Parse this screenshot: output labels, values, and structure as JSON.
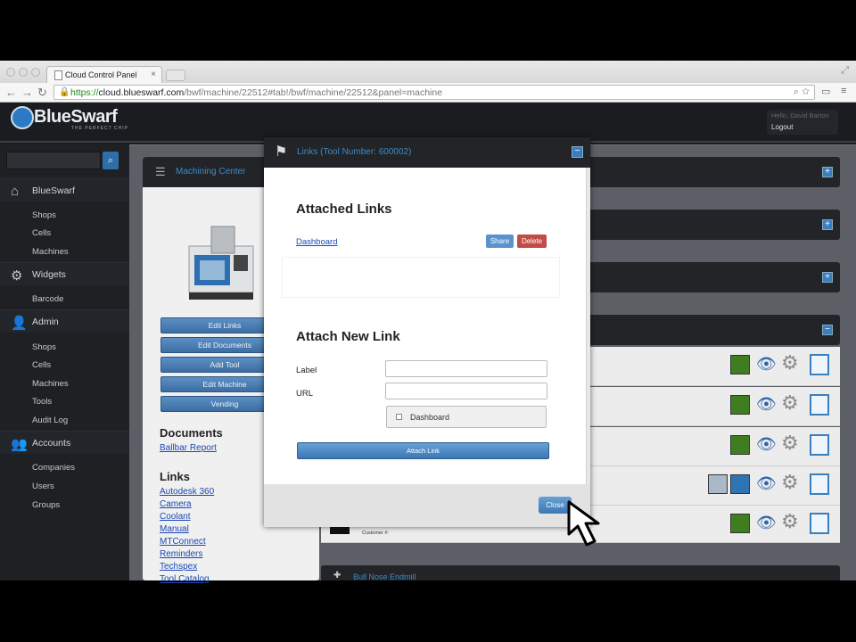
{
  "browser": {
    "tab_title": "Cloud Control Panel",
    "url_scheme": "https://",
    "url_host": "cloud.blueswarf.com",
    "url_path": "/bwf/machine/22512#tab!/bwf/machine/22512&panel=machine"
  },
  "header": {
    "logo_text": "BlueSwarf",
    "logo_sub": "THE PERFECT CHIP",
    "hello": "Hello, David Barton",
    "logout": "Logout"
  },
  "sidebar": {
    "sections": [
      {
        "label": "BlueSwarf",
        "icon": "home-icon",
        "items": [
          "Shops",
          "Cells",
          "Machines"
        ]
      },
      {
        "label": "Widgets",
        "icon": "gear-icon",
        "items": [
          "Barcode"
        ]
      },
      {
        "label": "Admin",
        "icon": "person-icon",
        "items": [
          "Shops",
          "Cells",
          "Machines",
          "Tools",
          "Audit Log"
        ]
      },
      {
        "label": "Accounts",
        "icon": "people-icon",
        "items": [
          "Companies",
          "Users",
          "Groups"
        ]
      }
    ]
  },
  "machine_panel": {
    "title": "Machining Center",
    "buttons": [
      "Edit Links",
      "Edit Documents",
      "Add Tool",
      "Edit Machine",
      "Vending"
    ],
    "documents_heading": "Documents",
    "documents": [
      "Ballbar Report"
    ],
    "links_heading": "Links",
    "links": [
      "Autodesk 360",
      "Camera",
      "Coolant",
      "Manual",
      "MTConnect",
      "Reminders",
      "Techspex",
      "Tool Catalog"
    ]
  },
  "bottom_panel": {
    "title": "Bull Nose Endmill"
  },
  "row_text": {
    "customer_label": "Customer #:"
  },
  "modal": {
    "title": "Links (Tool Number: 600002)",
    "attached_heading": "Attached Links",
    "attached_link": "Dashboard",
    "share_label": "Share",
    "delete_label": "Delete",
    "attach_heading": "Attach New Link",
    "label_field_label": "Label",
    "url_field_label": "URL",
    "checkbox_label": "Dashboard",
    "attach_button": "Attach Link",
    "close_button": "Close"
  },
  "colors": {
    "accent": "#3a7ec0",
    "delete": "#c24b47",
    "status_green": "#3f7e1f",
    "status_blue": "#2f75b5",
    "status_grey": "#a9b9c9"
  }
}
